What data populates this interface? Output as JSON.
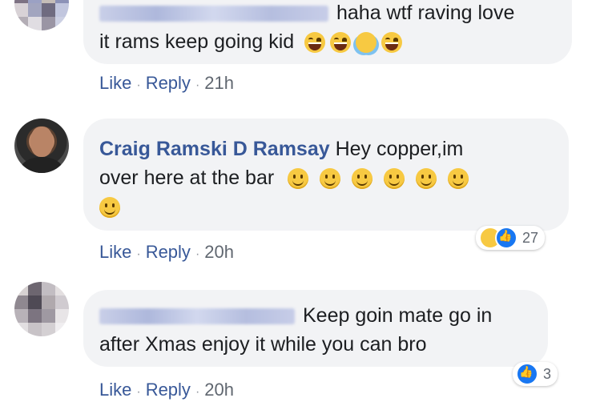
{
  "comments": [
    {
      "text_line1": "haha wtf raving love",
      "text_line2": "it rams keep going kid",
      "actions": {
        "like": "Like",
        "reply": "Reply",
        "time": "21h"
      }
    },
    {
      "author": "Craig Ramski D Ramsay",
      "text_line1": "Hey copper,im",
      "text_line2": "over here at the bar",
      "actions": {
        "like": "Like",
        "reply": "Reply",
        "time": "20h"
      },
      "reactions": {
        "icons": [
          "haha-icon",
          "like-icon"
        ],
        "count": "27"
      }
    },
    {
      "text_line1": "Keep goin mate go in",
      "text_line2": "after Xmas enjoy it while you can bro",
      "actions": {
        "like": "Like",
        "reply": "Reply",
        "time": "20h"
      },
      "reactions": {
        "icons": [
          "like-icon"
        ],
        "count": "3"
      }
    }
  ],
  "colors": {
    "name": "#385898",
    "bubble": "#f2f3f5",
    "meta": "#606770",
    "like_blue": "#1877f2"
  }
}
